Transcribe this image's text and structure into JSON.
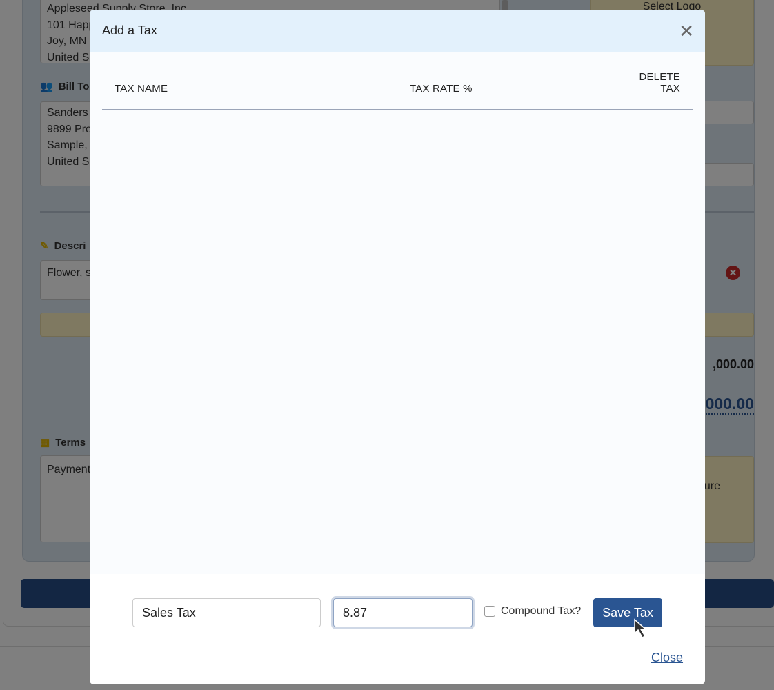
{
  "background": {
    "from_address": "Appleseed Supply Store, Inc\n101 Happ\nJoy, MN\nUnited S",
    "logo_label": "Select Logo",
    "bill_to_label": "Bill To",
    "bill_to_address": "Sanders\n9899 Pro\nSample,\nUnited S",
    "description_label": "Descri",
    "description_value": "Flower, s",
    "subtotal": ",000.00",
    "total": "000.00",
    "terms_label": "Terms",
    "terms_value": "Payment",
    "signature_label": "ure"
  },
  "modal": {
    "title": "Add a Tax",
    "columns": [
      "TAX NAME",
      "TAX RATE %",
      "DELETE TAX"
    ],
    "rows": [],
    "tax_name_value": "Sales Tax",
    "tax_rate_value": "8.87",
    "compound_label": "Compound Tax?",
    "compound_checked": false,
    "save_label": "Save Tax",
    "close_label": "Close"
  },
  "colors": {
    "accent": "#2a5592",
    "header_bg": "#e3f1fc",
    "delete_red": "#c62828"
  }
}
